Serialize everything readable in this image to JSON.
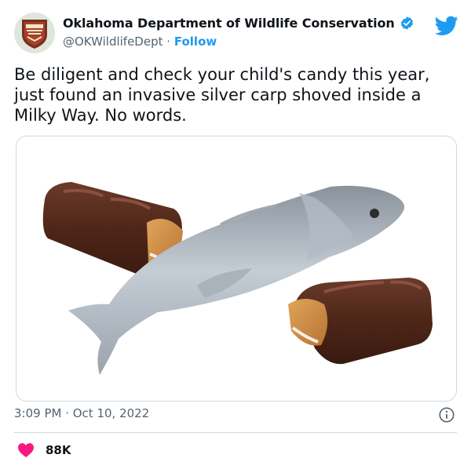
{
  "author": {
    "display_name": "Oklahoma Department of Wildlife Conservation",
    "handle": "@OKWildlifeDept",
    "separator": "·",
    "follow_label": "Follow",
    "avatar_icon": "odwc-badge-logo",
    "verified_icon": "verified-badge-icon",
    "platform_icon": "twitter-bird-icon"
  },
  "tweet": {
    "text": "Be diligent and check your child's candy this year,\njust found an invasive silver carp shoved inside a\nMilky Way. No words.",
    "timestamp": "3:09 PM · Oct 10, 2022"
  },
  "engagement": {
    "likes": "88K",
    "like_icon": "heart-icon"
  },
  "colors": {
    "accent": "#1d9bf0",
    "heart": "#f91880",
    "text": "#0f1419",
    "muted": "#536471",
    "border": "#cfd9de"
  }
}
